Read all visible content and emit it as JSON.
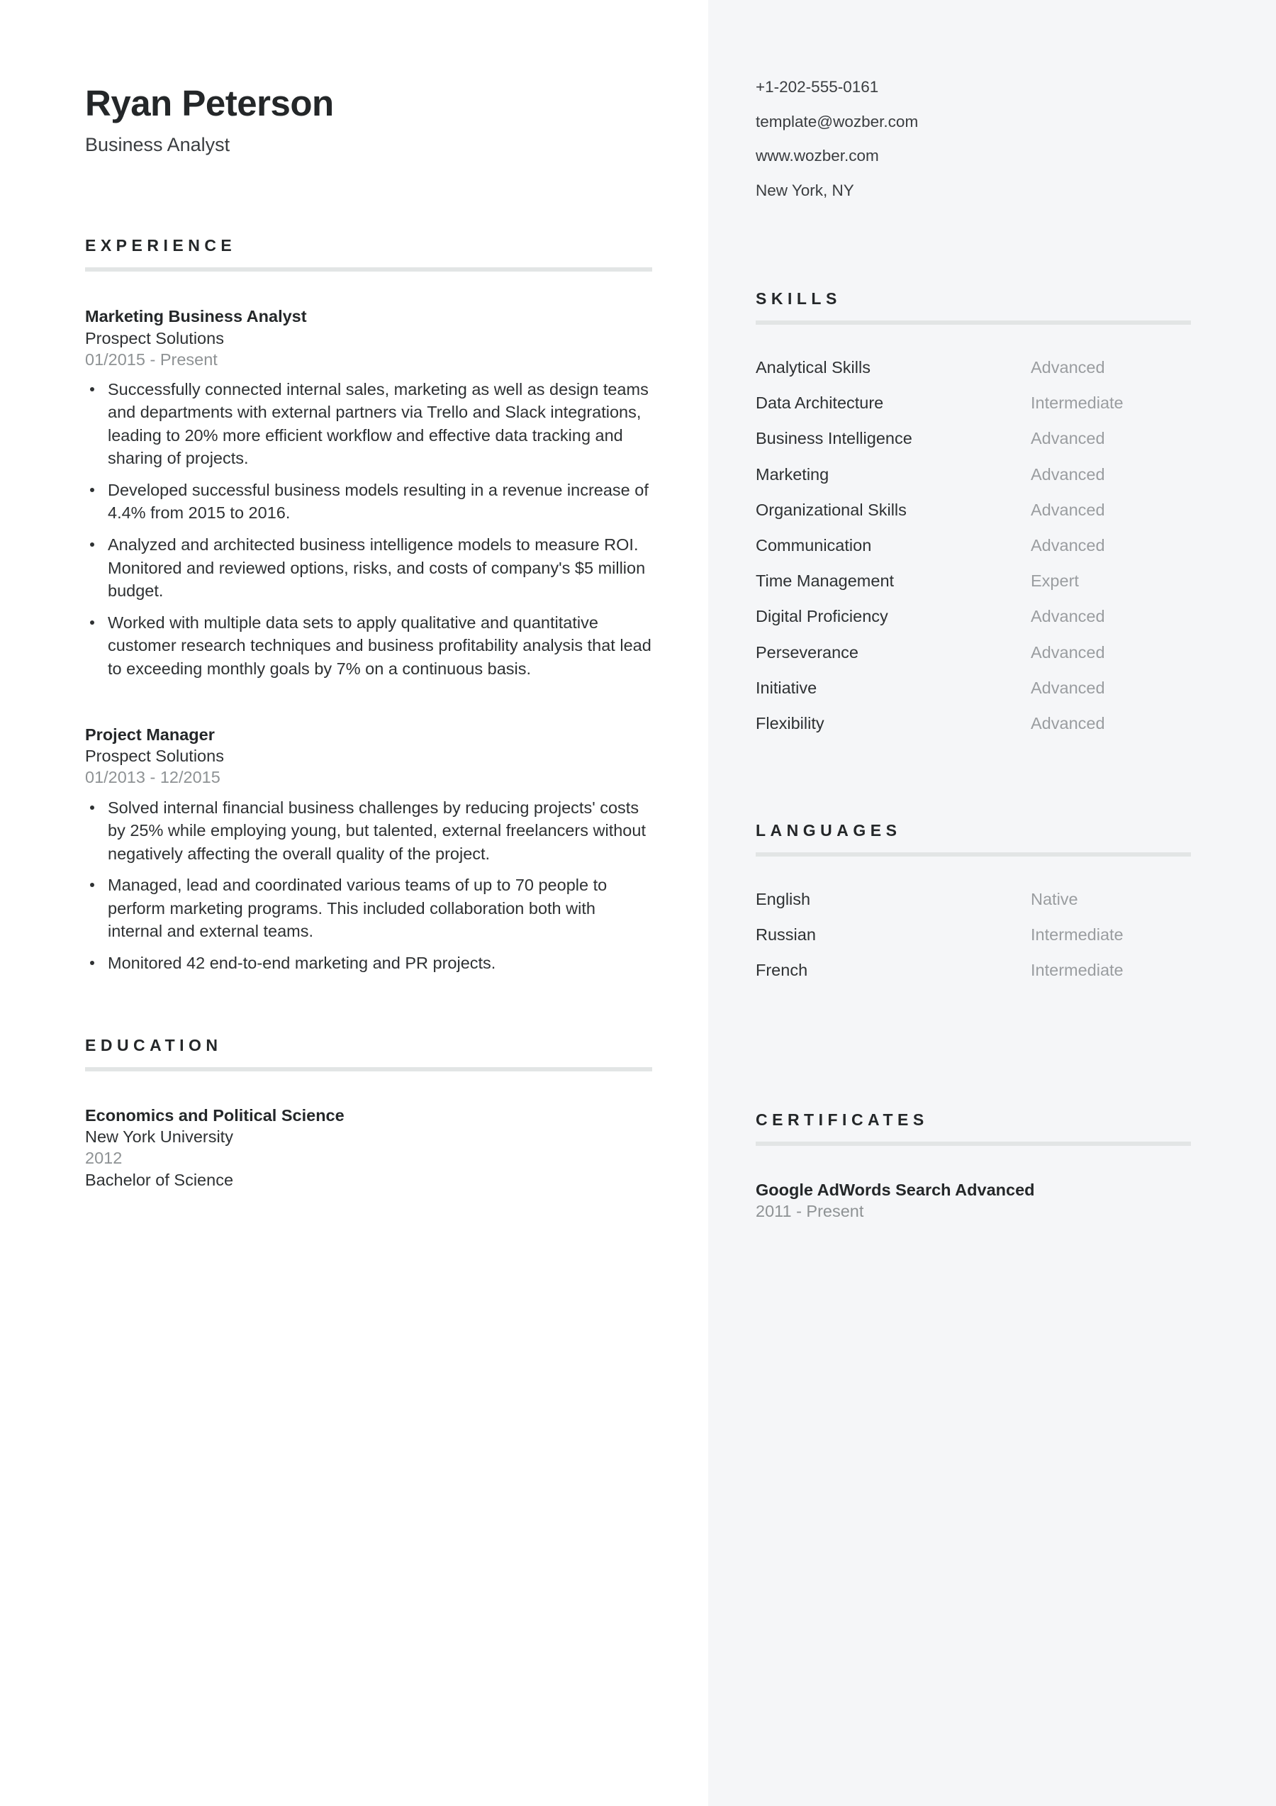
{
  "colors": {
    "page_bg": "#ffffff",
    "sidebar_bg": "#f5f6f8",
    "heading": "#242729",
    "body_text": "#2e3133",
    "muted_text": "#8e9294",
    "rule": "#e2e5e5"
  },
  "header": {
    "name": "Ryan Peterson",
    "job_title": "Business Analyst",
    "contacts": [
      "+1-202-555-0161",
      "template@wozber.com",
      "www.wozber.com",
      "New York, NY"
    ]
  },
  "experience": {
    "heading": "EXPERIENCE",
    "entries": [
      {
        "title": "Marketing Business Analyst",
        "organization": "Prospect Solutions",
        "date": "01/2015 - Present",
        "bullets": [
          "Successfully connected internal sales, marketing as well as design teams and departments with external partners via Trello and Slack integrations, leading to 20% more efficient workflow and effective data tracking and sharing of projects.",
          "Developed successful business models resulting in a revenue increase of 4.4% from 2015 to 2016.",
          "Analyzed and architected business intelligence models to measure ROI. Monitored and reviewed options, risks, and costs of company's $5 million budget.",
          "Worked with multiple data sets to apply qualitative and quantitative customer research techniques and business profitability analysis that lead to exceeding monthly goals by 7% on a continuous basis."
        ]
      },
      {
        "title": "Project Manager",
        "organization": "Prospect Solutions",
        "date": "01/2013 - 12/2015",
        "bullets": [
          "Solved internal financial business challenges by reducing projects' costs by 25% while employing young, but talented, external freelancers without negatively affecting the overall quality of the project.",
          "Managed, lead and coordinated various teams of up to 70 people to perform marketing programs. This included collaboration both with internal and external teams.",
          "Monitored 42 end-to-end marketing and PR projects."
        ]
      }
    ]
  },
  "education": {
    "heading": "EDUCATION",
    "entries": [
      {
        "field": "Economics and Political Science",
        "school": "New York University",
        "year": "2012",
        "degree": "Bachelor of Science"
      }
    ]
  },
  "skills": {
    "heading": "SKILLS",
    "items": [
      {
        "name": "Analytical Skills",
        "level": "Advanced"
      },
      {
        "name": "Data Architecture",
        "level": "Intermediate"
      },
      {
        "name": "Business Intelligence",
        "level": "Advanced"
      },
      {
        "name": "Marketing",
        "level": "Advanced"
      },
      {
        "name": "Organizational Skills",
        "level": "Advanced"
      },
      {
        "name": "Communication",
        "level": "Advanced"
      },
      {
        "name": "Time Management",
        "level": "Expert"
      },
      {
        "name": "Digital Proficiency",
        "level": "Advanced"
      },
      {
        "name": "Perseverance",
        "level": "Advanced"
      },
      {
        "name": "Initiative",
        "level": "Advanced"
      },
      {
        "name": "Flexibility",
        "level": "Advanced"
      }
    ]
  },
  "languages": {
    "heading": "LANGUAGES",
    "items": [
      {
        "name": "English",
        "level": "Native"
      },
      {
        "name": "Russian",
        "level": "Intermediate"
      },
      {
        "name": "French",
        "level": "Intermediate"
      }
    ]
  },
  "certificates": {
    "heading": "CERTIFICATES",
    "items": [
      {
        "name": "Google AdWords Search Advanced",
        "date": "2011 - Present"
      }
    ]
  }
}
